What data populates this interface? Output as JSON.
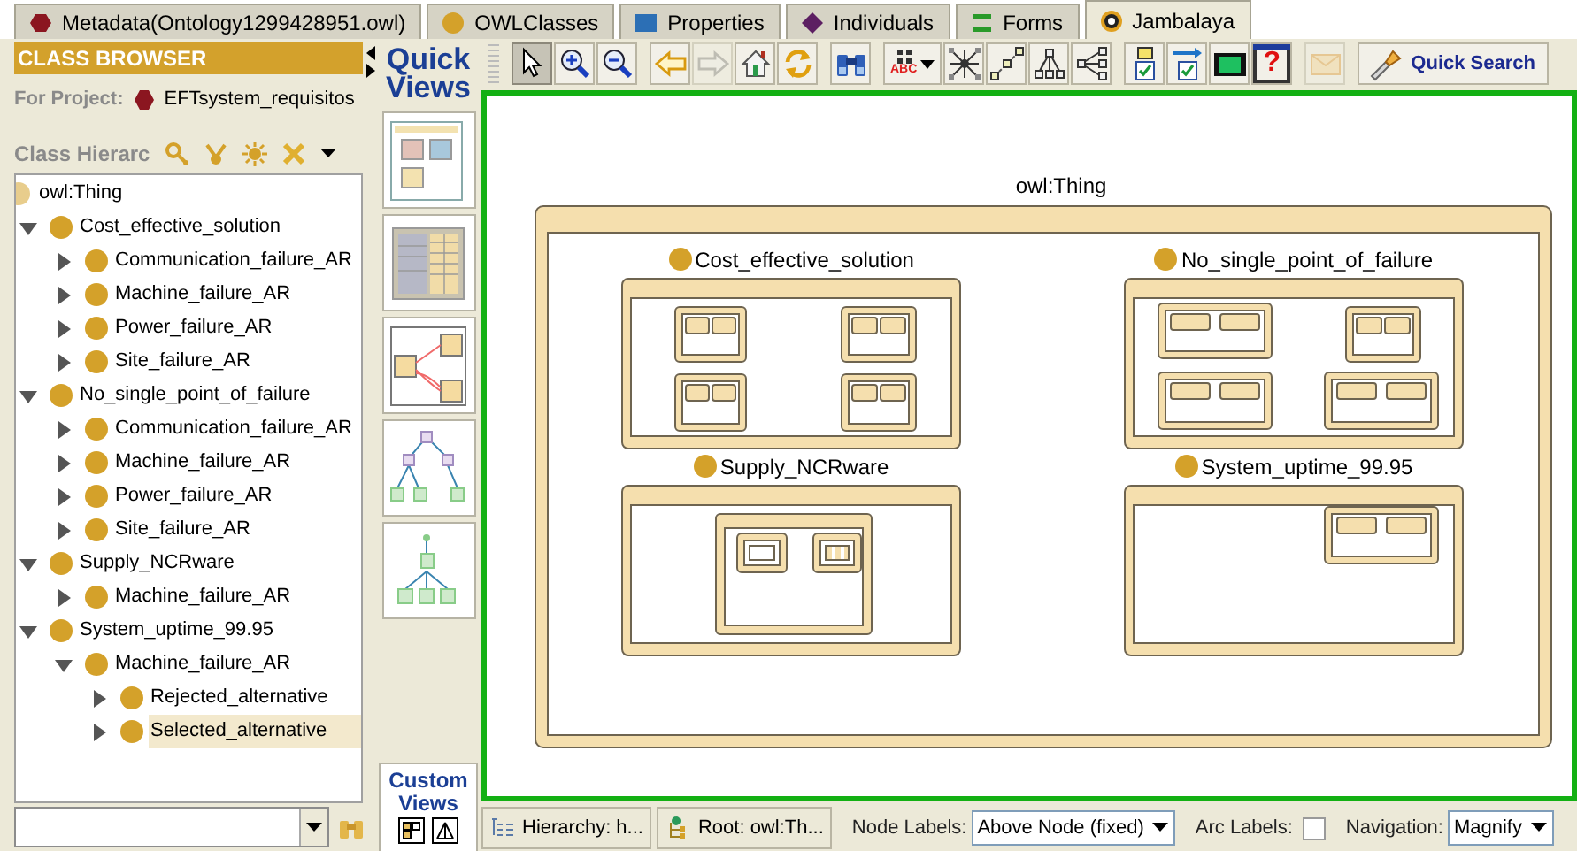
{
  "tabs": [
    {
      "label": "Metadata(Ontology1299428951.owl)",
      "kind": "metadata",
      "selected": false
    },
    {
      "label": "OWLClasses",
      "kind": "classes",
      "selected": false
    },
    {
      "label": "Properties",
      "kind": "properties",
      "selected": false
    },
    {
      "label": "Individuals",
      "kind": "individuals",
      "selected": false
    },
    {
      "label": "Forms",
      "kind": "forms",
      "selected": false
    },
    {
      "label": "Jambalaya",
      "kind": "jambalaya",
      "selected": true
    }
  ],
  "class_browser": {
    "title": "CLASS BROWSER",
    "project_label": "For Project:",
    "project_name": "EFTsystem_requisitos",
    "hierarchy_label": "Class Hierarc",
    "tree": [
      {
        "label": "owl:Thing",
        "color": "#e8cd8c",
        "selected": false,
        "children": [
          {
            "label": "Cost_effective_solution",
            "color": "#d4a12a",
            "expanded": true,
            "selected": false,
            "children": [
              {
                "label": "Communication_failure_AR",
                "color": "#d4a12a",
                "expanded": false,
                "selected": false
              },
              {
                "label": "Machine_failure_AR",
                "color": "#d4a12a",
                "expanded": false,
                "selected": false
              },
              {
                "label": "Power_failure_AR",
                "color": "#d4a12a",
                "expanded": false,
                "selected": false
              },
              {
                "label": "Site_failure_AR",
                "color": "#d4a12a",
                "expanded": false,
                "selected": false
              }
            ]
          },
          {
            "label": "No_single_point_of_failure",
            "color": "#d4a12a",
            "expanded": true,
            "selected": false,
            "children": [
              {
                "label": "Communication_failure_AR",
                "color": "#d4a12a",
                "expanded": false,
                "selected": false
              },
              {
                "label": "Machine_failure_AR",
                "color": "#d4a12a",
                "expanded": false,
                "selected": false
              },
              {
                "label": "Power_failure_AR",
                "color": "#d4a12a",
                "expanded": false,
                "selected": false
              },
              {
                "label": "Site_failure_AR",
                "color": "#d4a12a",
                "expanded": false,
                "selected": false
              }
            ]
          },
          {
            "label": "Supply_NCRware",
            "color": "#d4a12a",
            "expanded": true,
            "selected": false,
            "children": [
              {
                "label": "Machine_failure_AR",
                "color": "#d4a12a",
                "expanded": false,
                "selected": false
              }
            ]
          },
          {
            "label": "System_uptime_99.95",
            "color": "#d4a12a",
            "expanded": true,
            "selected": false,
            "children": [
              {
                "label": "Machine_failure_AR",
                "color": "#d4a12a",
                "expanded": true,
                "selected": false,
                "children": [
                  {
                    "label": "Rejected_alternative",
                    "color": "#d4a12a",
                    "expanded": false,
                    "selected": false
                  },
                  {
                    "label": "Selected_alternative",
                    "color": "#d4a12a",
                    "expanded": false,
                    "selected": true
                  }
                ]
              }
            ]
          }
        ]
      }
    ]
  },
  "quick_views": {
    "title": "Quick Views",
    "views": [
      {
        "kind": "nested"
      },
      {
        "kind": "treemap"
      },
      {
        "kind": "graph"
      },
      {
        "kind": "tree"
      },
      {
        "kind": "tree2"
      }
    ]
  },
  "custom_views": {
    "title": "Custom Views"
  },
  "toolbar": {
    "groups": [
      [
        {
          "kind": "pointer",
          "selected": true,
          "disabled": false
        },
        {
          "kind": "zoom_in",
          "selected": false,
          "disabled": false
        },
        {
          "kind": "zoom_out",
          "selected": false,
          "disabled": false
        }
      ],
      [
        {
          "kind": "back",
          "disabled": false
        },
        {
          "kind": "forward",
          "disabled": true
        },
        {
          "kind": "home",
          "disabled": false
        },
        {
          "kind": "refresh",
          "disabled": false
        }
      ],
      [
        {
          "kind": "find",
          "disabled": false
        }
      ],
      [
        {
          "kind": "layout",
          "label": "ABC",
          "disabled": false
        },
        {
          "kind": "network",
          "disabled": false
        },
        {
          "kind": "spring",
          "disabled": false
        },
        {
          "kind": "tree",
          "disabled": false
        },
        {
          "kind": "htree",
          "disabled": false
        }
      ],
      [
        {
          "kind": "checklist",
          "disabled": false
        },
        {
          "kind": "checklist_arrow",
          "disabled": false
        },
        {
          "kind": "film",
          "disabled": false
        },
        {
          "kind": "help",
          "label": "?",
          "disabled": false
        }
      ],
      [
        {
          "kind": "mail",
          "disabled": true
        }
      ],
      [
        {
          "kind": "quick_search",
          "label": "Quick Search",
          "disabled": false
        }
      ]
    ]
  },
  "diagram": {
    "root": {
      "label": "owl:Thing"
    },
    "nodes": [
      {
        "label": "Cost_effective_solution",
        "kind": "grid"
      },
      {
        "label": "No_single_point_of_failure",
        "kind": "mixed"
      },
      {
        "label": "Supply_NCRware",
        "kind": "nested"
      },
      {
        "label": "System_uptime_99.95",
        "kind": "single"
      }
    ]
  },
  "bottom_bar": {
    "hierarchy": "Hierarchy: h...",
    "root": "Root: owl:Th...",
    "node_labels_label": "Node Labels:",
    "node_labels_value": "Above Node (fixed)",
    "arc_labels_label": "Arc Labels:",
    "arc_labels_checked": false,
    "navigation_label": "Navigation:",
    "navigation_value": "Magnify"
  }
}
